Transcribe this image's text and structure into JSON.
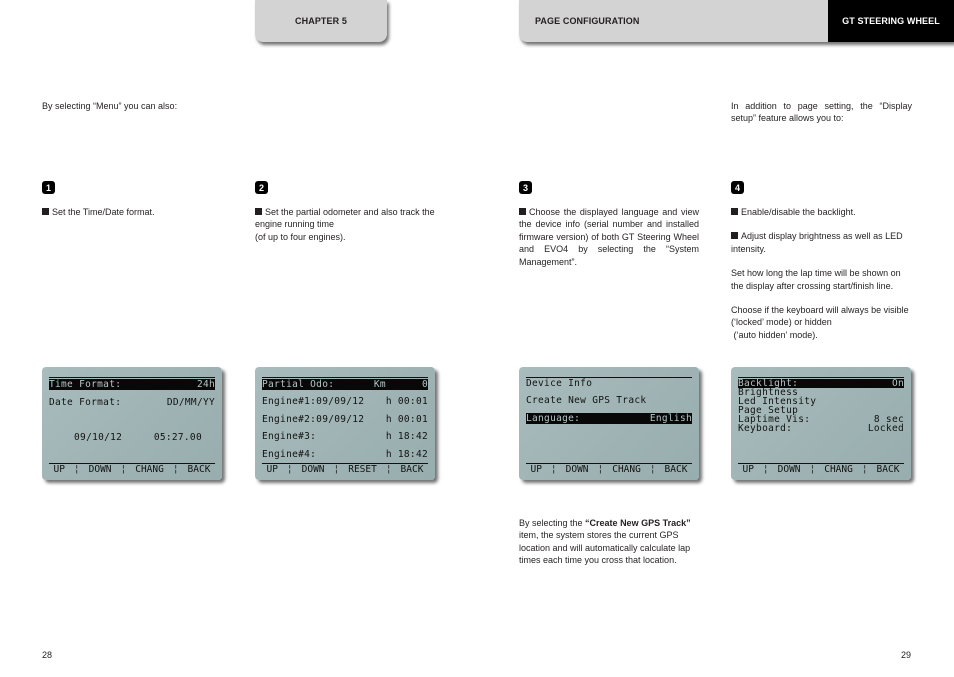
{
  "header": {
    "chapter": "CHAPTER 5",
    "section": "PAGE  CONFIGURATION",
    "product": "GT STEERING WHEEL"
  },
  "intro_left": "By selecting “Menu” you can also:",
  "intro_right": "In addition to page setting, the “Display setup” feature allows you to:",
  "items": [
    {
      "number": "1",
      "paragraphs": [
        "Set the Time/Date format."
      ]
    },
    {
      "number": "2",
      "paragraphs": [
        "Set the partial odometer and also track the engine running time",
        "(of up to four engines)."
      ]
    },
    {
      "number": "3",
      "paragraphs": [
        "Choose the displayed language and view the device info (serial number and installed firmware version) of both GT Steering Wheel and EVO4 by selecting the “System Management”."
      ]
    },
    {
      "number": "4",
      "paragraphs": [
        "Enable/disable the backlight.",
        "Adjust display brightness as well as LED intensity.",
        "Set how long the lap time will be shown on the display after crossing start/finish line.",
        "Choose if the keyboard will always be visible (‘locked’ mode) or hidden",
        " (‘auto hidden’ mode)."
      ]
    }
  ],
  "displays": [
    {
      "rows": [
        {
          "left": "Time Format:",
          "right": "24h",
          "selected": true
        },
        {
          "left": "Date Format:",
          "right": "DD/MM/YY",
          "selected": false
        },
        {
          "left": "",
          "right": "",
          "selected": false
        },
        {
          "left": "  09/10/12",
          "right": "05:27.00 ",
          "selected": false
        }
      ],
      "softkeys": [
        "UP",
        "DOWN",
        "CHANG",
        "BACK"
      ]
    },
    {
      "rows": [
        {
          "left": "Partial Odo:",
          "right": "Km      0",
          "selected": true
        },
        {
          "left": "Engine#1:09/09/12",
          "right": "h 00:01",
          "selected": false
        },
        {
          "left": "Engine#2:09/09/12",
          "right": "h 00:01",
          "selected": false
        },
        {
          "left": "Engine#3:",
          "right": "h 18:42",
          "selected": false
        },
        {
          "left": "Engine#4:",
          "right": "h 18:42",
          "selected": false
        }
      ],
      "softkeys": [
        "UP",
        "DOWN",
        "RESET",
        "BACK"
      ]
    },
    {
      "rows": [
        {
          "left": "Device Info",
          "right": "",
          "selected": false
        },
        {
          "left": "Create New GPS Track",
          "right": "",
          "selected": false
        },
        {
          "left": "Language:",
          "right": "English",
          "selected": true
        }
      ],
      "softkeys": [
        "UP",
        "DOWN",
        "CHANG",
        "BACK"
      ]
    },
    {
      "rows": [
        {
          "left": "Backlight:",
          "right": "On",
          "selected": true
        },
        {
          "left": "Brightness",
          "right": "",
          "selected": false
        },
        {
          "left": "Led Intensity",
          "right": "",
          "selected": false
        },
        {
          "left": "Page Setup",
          "right": "",
          "selected": false
        },
        {
          "left": "Laptime Vis:",
          "right": "8 sec",
          "selected": false
        },
        {
          "left": "Keyboard:",
          "right": "Locked",
          "selected": false
        }
      ],
      "softkeys": [
        "UP",
        "DOWN",
        "CHANG",
        "BACK"
      ]
    }
  ],
  "gps_note": {
    "prefix": "By selecting the ",
    "bold": "“Create New GPS Track”",
    "suffix": " item, the system stores the current GPS location and will automatically calculate lap times each time you cross that location."
  },
  "page_numbers": {
    "left": "28",
    "right": "29"
  },
  "colors": {
    "tab_gray": "#d3d3d3",
    "brand_black": "#000000",
    "lcd_background": "#a9bcbd",
    "lcd_text": "#121212"
  }
}
